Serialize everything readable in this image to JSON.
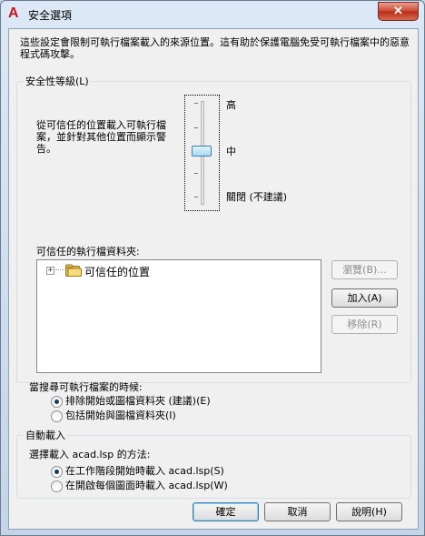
{
  "window": {
    "title": "安全選項",
    "app_icon": "autocad-icon",
    "close_glyph": "✕"
  },
  "description": "這些設定會限制可執行檔案載入的來源位置。這有助於保護電腦免受可執行檔案中的惡意程式碼攻擊。",
  "security_level": {
    "group_label": "安全性等級(L)",
    "explanation": "從可信任的位置載入可執行檔案，並針對其他位置而顯示警告。",
    "levels": [
      "高",
      "中",
      "關閉 (不建議)"
    ],
    "selected": "中"
  },
  "trusted_folders": {
    "label": "可信任的執行檔資料夾:",
    "tree_item": "可信任的位置",
    "expander": "+",
    "browse_button": "瀏覽(B)...",
    "add_button": "加入(A)",
    "remove_button": "移除(R)"
  },
  "search": {
    "label": "當搜尋可執行檔案的時候:",
    "options": [
      "排除開始或圖檔資料夾 (建議)(E)",
      "包括開始與圖檔資料夾(I)"
    ],
    "selected_index": 0
  },
  "autoload": {
    "group_label": "自動載入",
    "label": "選擇載入 acad.lsp 的方法:",
    "options": [
      "在工作階段開始時載入 acad.lsp(S)",
      "在開啟每個圖面時載入 acad.lsp(W)"
    ],
    "selected_index": 0
  },
  "footer": {
    "ok": "確定",
    "cancel": "取消",
    "help": "說明(H)"
  }
}
